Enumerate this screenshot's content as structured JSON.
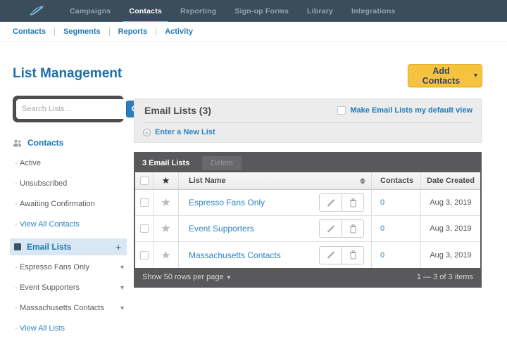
{
  "nav": {
    "items": [
      {
        "label": "Campaigns"
      },
      {
        "label": "Contacts",
        "active": true
      },
      {
        "label": "Reporting"
      },
      {
        "label": "Sign-up Forms"
      },
      {
        "label": "Library"
      },
      {
        "label": "Integrations"
      }
    ]
  },
  "subnav": {
    "items": [
      "Contacts",
      "Segments",
      "Reports",
      "Activity"
    ]
  },
  "page": {
    "title": "List Management",
    "add_contacts_label": "Add Contacts"
  },
  "search": {
    "placeholder": "Search Lists..."
  },
  "sidebar": {
    "contacts_header": "Contacts",
    "contacts_items": [
      "Active",
      "Unsubscribed",
      "Awaiting Confirmation"
    ],
    "view_all_contacts": "View All Contacts",
    "email_lists_header": "Email Lists",
    "email_lists_items": [
      "Espresso Fans Only",
      "Event Supporters",
      "Massachusetts Contacts"
    ],
    "view_all_lists": "View All Lists"
  },
  "panel": {
    "title": "Email Lists (3)",
    "default_view_label": "Make Email Lists my default view",
    "new_list_label": "Enter a New List"
  },
  "table": {
    "toolbar": {
      "count_label": "3 Email Lists",
      "delete_label": "Delete"
    },
    "headers": {
      "star": "★",
      "list_name": "List Name",
      "contacts": "Contacts",
      "date_created": "Date Created"
    },
    "rows": [
      {
        "name": "Espresso Fans Only",
        "contacts": "0",
        "date": "Aug 3, 2019"
      },
      {
        "name": "Event Supporters",
        "contacts": "0",
        "date": "Aug 3, 2019"
      },
      {
        "name": "Massachusetts Contacts",
        "contacts": "0",
        "date": "Aug 3, 2019"
      }
    ],
    "footer": {
      "rows_per_page": "Show 50 rows per page",
      "range": "1 — 3 of 3 items"
    }
  },
  "icons": {
    "star": "★",
    "caret_down": "▾",
    "dash": "-",
    "plus": "+",
    "circle_plus": "+"
  },
  "colors": {
    "nav_bg": "#3b4c5a",
    "nav_active_underline": "#62aede",
    "link_blue": "#2e86c1",
    "title_blue": "#1a6fad",
    "accent_yellow": "#f6c340",
    "dark_bar": "#59595b",
    "panel_gray": "#ececec"
  }
}
